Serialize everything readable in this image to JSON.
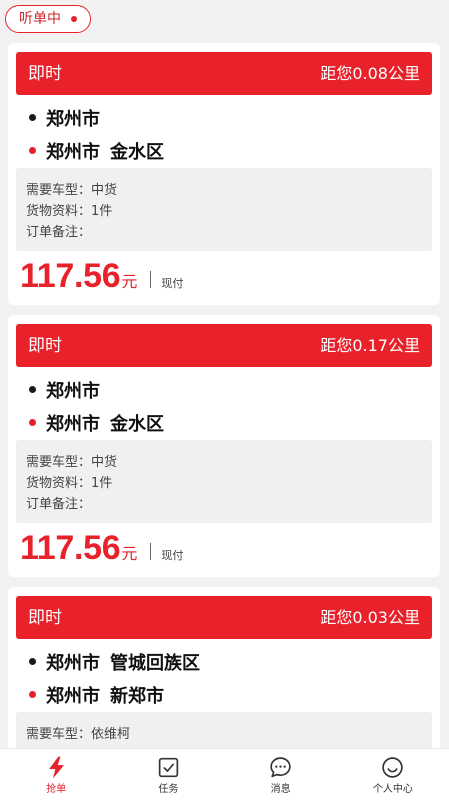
{
  "status_badge": {
    "label": "听单中"
  },
  "orders": [
    {
      "type": "即时",
      "distance": "距您0.08公里",
      "from": {
        "city": "郑州市"
      },
      "to": {
        "city": "郑州市",
        "district": "金水区"
      },
      "details": [
        "需要车型：中货",
        "货物资料：1件",
        "订单备注："
      ],
      "price": "117.56",
      "currency": "元",
      "payment": "现付"
    },
    {
      "type": "即时",
      "distance": "距您0.17公里",
      "from": {
        "city": "郑州市"
      },
      "to": {
        "city": "郑州市",
        "district": "金水区"
      },
      "details": [
        "需要车型：中货",
        "货物资料：1件",
        "订单备注："
      ],
      "price": "117.56",
      "currency": "元",
      "payment": "现付"
    },
    {
      "type": "即时",
      "distance": "距您0.03公里",
      "from": {
        "city": "郑州市",
        "district": "管城回族区"
      },
      "to": {
        "city": "郑州市",
        "district": "新郑市"
      },
      "details": [
        "需要车型：依维柯"
      ]
    }
  ],
  "tabbar": {
    "items": [
      {
        "label": "抢单",
        "icon": "lightning-icon",
        "active": true
      },
      {
        "label": "任务",
        "icon": "task-check-icon",
        "active": false
      },
      {
        "label": "消息",
        "icon": "message-bubble-icon",
        "active": false
      },
      {
        "label": "个人中心",
        "icon": "profile-smile-icon",
        "active": false
      }
    ]
  },
  "colors": {
    "accent": "#e8212b",
    "from_dot": "#1a1a1a",
    "to_dot": "#e8212b",
    "page_background": "#f2f2f2",
    "detail_background": "#f0f0f0",
    "inactive_tab": "#333333"
  }
}
